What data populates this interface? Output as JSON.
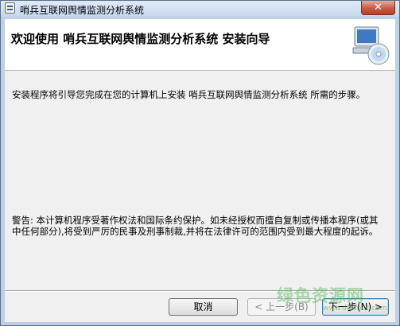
{
  "window": {
    "title": "哨兵互联网舆情监测分析系统",
    "close_glyph": "✕"
  },
  "banner": {
    "heading": "欢迎使用  哨兵互联网舆情监测分析系统  安装向导",
    "icon": "computer-cd-icon"
  },
  "content": {
    "intro": "安装程序将引导您完成在您的计算机上安装 哨兵互联网舆情监测分析系统 所需的步骤。",
    "warning": "警告: 本计算机程序受著作权法和国际条约保护。如未经授权而擅自复制或传播本程序(或其中任何部分),将受到严厉的民事及刑事制裁,并将在法律许可的范围内受到最大程度的起诉。"
  },
  "buttons": {
    "cancel": "取消",
    "back": "< 上一步(B)",
    "next": "下一步(N) >"
  },
  "watermark": {
    "text": "绿色资源网",
    "sub": "www.downcc.com"
  },
  "colors": {
    "frame": "#bcd0e6",
    "close": "#c85a44",
    "content_bg": "#f0f0f0"
  }
}
